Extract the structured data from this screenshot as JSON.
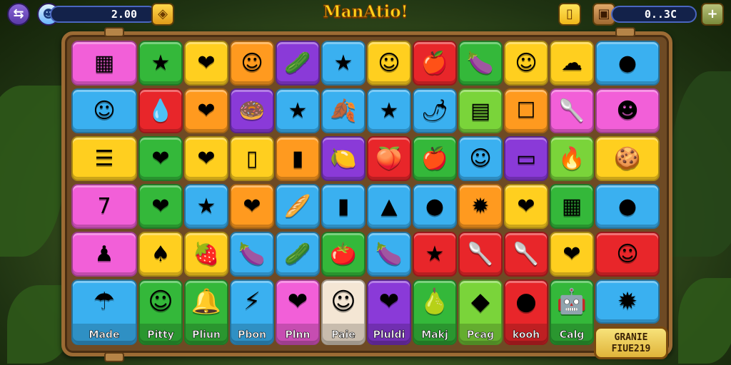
{
  "header": {
    "title": "ManAtio!",
    "score": "2.00",
    "coins": "0..3C",
    "back_icon": "back-arrow-icon",
    "plus_label": "+"
  },
  "colors": {
    "pink": "#f25fd8",
    "green": "#34b83a",
    "yellow": "#ffcf1f",
    "orange": "#ff9a1f",
    "purple": "#8a3ad8",
    "blue": "#3ab0f0",
    "red": "#e8262a",
    "lime": "#7ad43a",
    "cream": "#f4e6d4"
  },
  "grid": {
    "rows": [
      [
        {
          "color": "pink",
          "glyph": "▦",
          "icon": "crate-icon"
        },
        {
          "color": "green",
          "glyph": "★",
          "icon": "star-icon"
        },
        {
          "color": "yellow",
          "glyph": "❤",
          "icon": "heart-icon"
        },
        {
          "color": "orange",
          "glyph": "☺",
          "icon": "face-icon"
        },
        {
          "color": "purple",
          "glyph": "🥒",
          "icon": "pickle-icon"
        },
        {
          "color": "blue",
          "glyph": "★",
          "icon": "star-icon"
        },
        {
          "color": "yellow",
          "glyph": "☺",
          "icon": "face-icon"
        },
        {
          "color": "red",
          "glyph": "🍎",
          "icon": "apple-icon"
        },
        {
          "color": "green",
          "glyph": "🍆",
          "icon": "eggplant-icon"
        },
        {
          "color": "yellow",
          "glyph": "☺",
          "icon": "face-icon"
        },
        {
          "color": "yellow",
          "glyph": "☁",
          "icon": "cloud-icon"
        },
        {
          "color": "blue",
          "glyph": "●",
          "icon": "blob-icon"
        }
      ],
      [
        {
          "color": "blue",
          "glyph": "☺",
          "icon": "face-icon"
        },
        {
          "color": "red",
          "glyph": "💧",
          "icon": "drop-icon"
        },
        {
          "color": "orange",
          "glyph": "❤",
          "icon": "heart-icon"
        },
        {
          "color": "purple",
          "glyph": "🍩",
          "icon": "donut-icon"
        },
        {
          "color": "blue",
          "glyph": "★",
          "icon": "star-icon"
        },
        {
          "color": "blue",
          "glyph": "🍂",
          "icon": "leaf-icon"
        },
        {
          "color": "blue",
          "glyph": "★",
          "icon": "star-icon"
        },
        {
          "color": "blue",
          "glyph": "🌶",
          "icon": "pepper-icon"
        },
        {
          "color": "lime",
          "glyph": "▤",
          "icon": "box-icon"
        },
        {
          "color": "orange",
          "glyph": "☐",
          "icon": "jar-icon"
        },
        {
          "color": "pink",
          "glyph": "🥄",
          "icon": "spoon-icon"
        },
        {
          "color": "pink",
          "glyph": "☻",
          "icon": "monster-icon"
        }
      ],
      [
        {
          "color": "yellow",
          "glyph": "☰",
          "icon": "note-icon"
        },
        {
          "color": "green",
          "glyph": "❤",
          "icon": "heart-icon"
        },
        {
          "color": "yellow",
          "glyph": "❤",
          "icon": "heart-icon"
        },
        {
          "color": "yellow",
          "glyph": "▯",
          "icon": "card-icon"
        },
        {
          "color": "orange",
          "glyph": "▮",
          "icon": "tablet-icon"
        },
        {
          "color": "purple",
          "glyph": "🍋",
          "icon": "lemon-icon"
        },
        {
          "color": "red",
          "glyph": "🍑",
          "icon": "plum-icon"
        },
        {
          "color": "green",
          "glyph": "🍎",
          "icon": "apple-icon"
        },
        {
          "color": "blue",
          "glyph": "☺",
          "icon": "face-icon"
        },
        {
          "color": "purple",
          "glyph": "▭",
          "icon": "screen-icon"
        },
        {
          "color": "lime",
          "glyph": "🔥",
          "icon": "flame-icon"
        },
        {
          "color": "yellow",
          "glyph": "🍪",
          "icon": "cookie-icon"
        }
      ],
      [
        {
          "color": "pink",
          "glyph": "7",
          "icon": "seven-icon"
        },
        {
          "color": "green",
          "glyph": "❤",
          "icon": "heart-icon"
        },
        {
          "color": "blue",
          "glyph": "★",
          "icon": "star-icon"
        },
        {
          "color": "orange",
          "glyph": "❤",
          "icon": "heart-icon"
        },
        {
          "color": "blue",
          "glyph": "🥖",
          "icon": "bread-icon"
        },
        {
          "color": "blue",
          "glyph": "▮",
          "icon": "cup-icon"
        },
        {
          "color": "blue",
          "glyph": "▲",
          "icon": "bell-icon"
        },
        {
          "color": "blue",
          "glyph": "●",
          "icon": "bubble-icon"
        },
        {
          "color": "orange",
          "glyph": "✹",
          "icon": "splat-icon"
        },
        {
          "color": "yellow",
          "glyph": "❤",
          "icon": "heart-icon"
        },
        {
          "color": "green",
          "glyph": "▦",
          "icon": "crate-icon"
        },
        {
          "color": "blue",
          "glyph": "●",
          "icon": "blob-icon"
        }
      ],
      [
        {
          "color": "pink",
          "glyph": "♟",
          "icon": "bottle-icon"
        },
        {
          "color": "yellow",
          "glyph": "♠",
          "icon": "sack-icon"
        },
        {
          "color": "yellow",
          "glyph": "🍓",
          "icon": "strawberry-icon"
        },
        {
          "color": "blue",
          "glyph": "🍆",
          "icon": "eggplant-icon"
        },
        {
          "color": "blue",
          "glyph": "🥒",
          "icon": "cucumber-icon"
        },
        {
          "color": "green",
          "glyph": "🍅",
          "icon": "tomato-icon"
        },
        {
          "color": "blue",
          "glyph": "🍆",
          "icon": "eggplant-icon"
        },
        {
          "color": "red",
          "glyph": "★",
          "icon": "star-icon"
        },
        {
          "color": "red",
          "glyph": "🥄",
          "icon": "spoon-icon"
        },
        {
          "color": "red",
          "glyph": "🥄",
          "icon": "spoon-icon"
        },
        {
          "color": "yellow",
          "glyph": "❤",
          "icon": "heart-icon"
        },
        {
          "color": "red",
          "glyph": "☺",
          "icon": "face-icon"
        }
      ]
    ],
    "bottom": [
      {
        "color": "blue",
        "glyph": "☂",
        "icon": "hook-icon",
        "label": "Made"
      },
      {
        "color": "green",
        "glyph": "☺",
        "icon": "face-icon",
        "label": "Pitty"
      },
      {
        "color": "green",
        "glyph": "🔔",
        "icon": "bell-icon",
        "label": "Pliun"
      },
      {
        "color": "blue",
        "glyph": "⚡",
        "icon": "bolt-icon",
        "label": "Pbon"
      },
      {
        "color": "pink",
        "glyph": "❤",
        "icon": "heart-icon",
        "label": "Plnn"
      },
      {
        "color": "cream",
        "glyph": "☺",
        "icon": "face-icon",
        "label": "Paie"
      },
      {
        "color": "purple",
        "glyph": "❤",
        "icon": "heart-icon",
        "label": "Pluldi"
      },
      {
        "color": "green",
        "glyph": "🍐",
        "icon": "pear-icon",
        "label": "Makj"
      },
      {
        "color": "lime",
        "glyph": "◆",
        "icon": "card-icon",
        "label": "Pcag"
      },
      {
        "color": "red",
        "glyph": "●",
        "icon": "ball-icon",
        "label": "kooh"
      },
      {
        "color": "green",
        "glyph": "🤖",
        "icon": "robot-icon",
        "label": "Calg"
      },
      {
        "color": "blue",
        "glyph": "✹",
        "icon": "sun-icon",
        "label": ""
      }
    ]
  },
  "badge": {
    "line1": "GRANIE",
    "line2": "FIUE219"
  }
}
